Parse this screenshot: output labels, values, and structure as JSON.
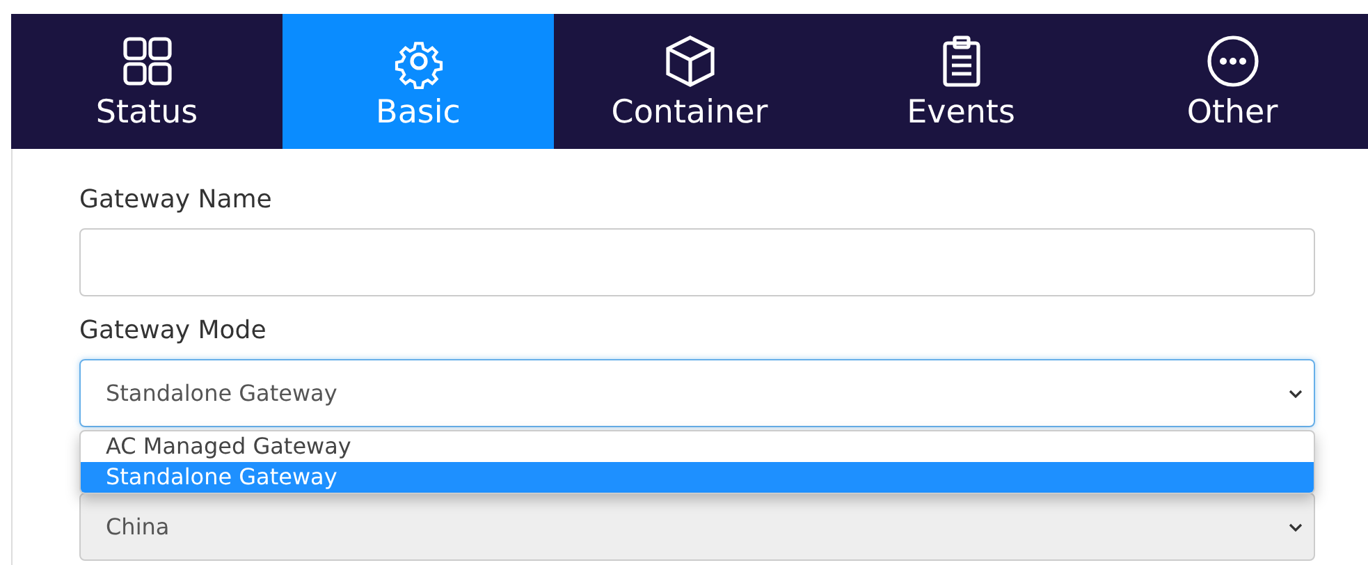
{
  "tabs": [
    {
      "label": "Status",
      "kind": "grid",
      "selected": false
    },
    {
      "label": "Basic",
      "kind": "gear",
      "selected": true
    },
    {
      "label": "Container",
      "kind": "cube",
      "selected": false
    },
    {
      "label": "Events",
      "kind": "clipboard",
      "selected": false
    },
    {
      "label": "Other",
      "kind": "dots",
      "selected": false
    }
  ],
  "gateway_name": {
    "label": "Gateway Name"
  },
  "gateway_mode": {
    "label": "Gateway Mode",
    "value": "Standalone Gateway",
    "options": [
      {
        "label": "AC Managed Gateway",
        "selected": false
      },
      {
        "label": "Standalone Gateway",
        "selected": true
      }
    ]
  },
  "country": {
    "value": "China",
    "disabled": true
  }
}
